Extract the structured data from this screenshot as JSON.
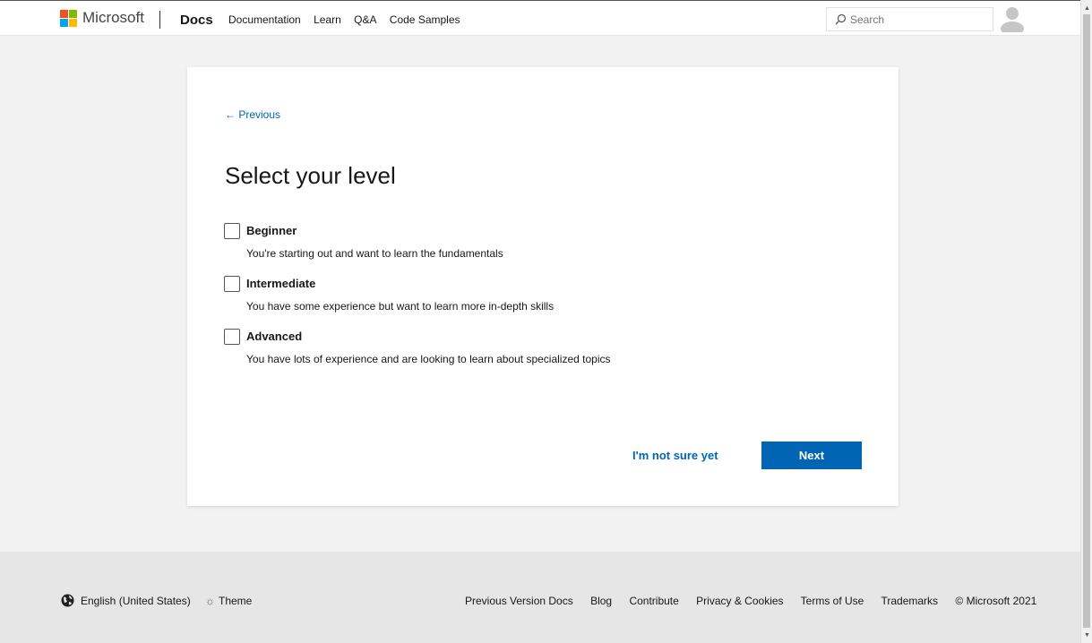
{
  "header": {
    "brand": "Microsoft",
    "product": "Docs",
    "nav": [
      "Documentation",
      "Learn",
      "Q&A",
      "Code Samples"
    ],
    "search": {
      "placeholder": "Search",
      "value": ""
    }
  },
  "card": {
    "previous_label": "← Previous",
    "title": "Select your level",
    "options": [
      {
        "label": "Beginner",
        "description": "You're starting out and want to learn the fundamentals",
        "checked": false
      },
      {
        "label": "Intermediate",
        "description": "You have some experience but want to learn more in-depth skills",
        "checked": false
      },
      {
        "label": "Advanced",
        "description": "You have lots of experience and are looking to learn about specialized topics",
        "checked": false
      }
    ],
    "not_sure_label": "I'm not sure yet",
    "next_label": "Next"
  },
  "footer": {
    "locale": "English (United States)",
    "theme": "Theme",
    "theme_icon": "☼",
    "links": [
      "Previous Version Docs",
      "Blog",
      "Contribute",
      "Privacy & Cookies",
      "Terms of Use",
      "Trademarks"
    ],
    "copyright": "© Microsoft 2021"
  },
  "colors": {
    "accent": "#0065b3",
    "page_background": "#f2f2f2",
    "footer_background": "#e6e6e6"
  },
  "icons": {
    "logo": "microsoft-logo-icon",
    "search": "search-icon",
    "avatar": "user-avatar-icon",
    "globe": "globe-icon",
    "theme": "sun-icon"
  }
}
